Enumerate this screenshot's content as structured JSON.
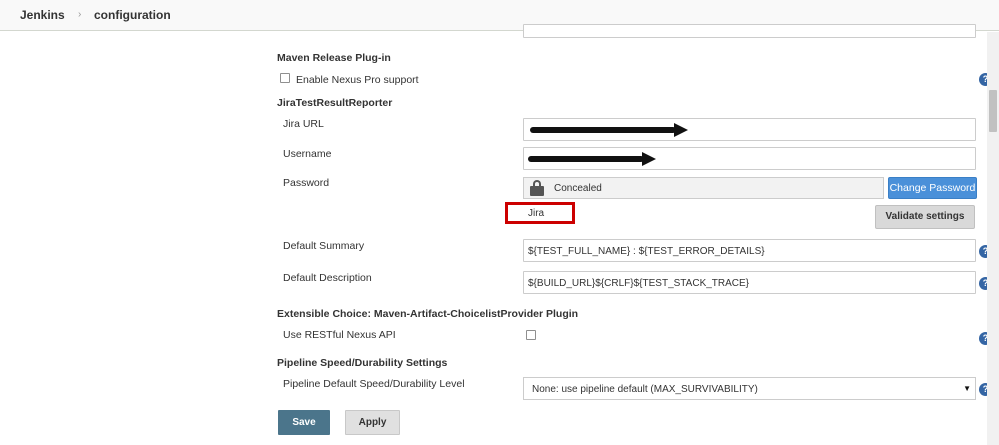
{
  "breadcrumb": {
    "root": "Jenkins",
    "current": "configuration"
  },
  "sections": {
    "maven_release": {
      "title": "Maven Release Plug-in",
      "nexus_label": "Enable Nexus Pro support",
      "nexus_checked": false
    },
    "jira": {
      "title": "JiraTestResultReporter",
      "url_label": "Jira URL",
      "username_label": "Username",
      "password_label": "Password",
      "password_value": "Concealed",
      "change_password_label": "Change Password",
      "jira_text": "Jira",
      "validate_label": "Validate settings",
      "summary_label": "Default Summary",
      "summary_value": "${TEST_FULL_NAME} : ${TEST_ERROR_DETAILS}",
      "description_label": "Default Description",
      "description_value": "${BUILD_URL}${CRLF}${TEST_STACK_TRACE}"
    },
    "extensible_choice": {
      "title": "Extensible Choice: Maven-Artifact-ChoicelistProvider Plugin",
      "restful_label": "Use RESTful Nexus API",
      "restful_checked": false
    },
    "pipeline": {
      "title": "Pipeline Speed/Durability Settings",
      "level_label": "Pipeline Default Speed/Durability Level",
      "level_value": "None: use pipeline default (MAX_SURVIVABILITY)"
    }
  },
  "footer": {
    "save_label": "Save",
    "apply_label": "Apply"
  },
  "colors": {
    "primary_button": "#4a90d9",
    "save_button": "#4b758b",
    "highlight_box": "#cc0000",
    "help_icon": "#3465a4"
  },
  "icons": {
    "help": "question-mark",
    "lock": "padlock",
    "dropdown": "triangle-down"
  },
  "help_glyph": "?",
  "dropdown_glyph": "▼",
  "breadcrumb_separator": "›"
}
